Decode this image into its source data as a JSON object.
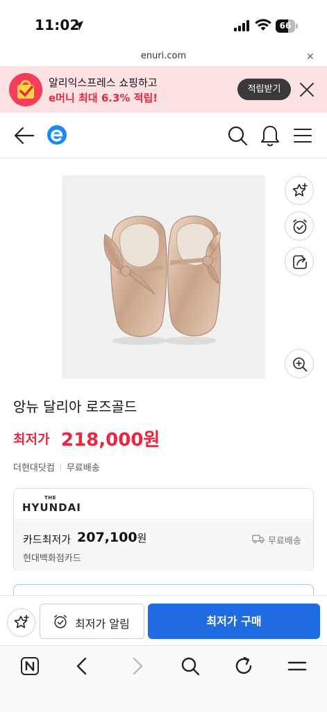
{
  "status_bar": {
    "time": "11:02",
    "battery": "66",
    "battery_level": 0.66
  },
  "browser": {
    "url": "enuri.com"
  },
  "promo": {
    "line1": "알리익스프레스 쇼핑하고",
    "line2": "e머니 최대 6.3% 적립!",
    "button_label": "적립받기"
  },
  "product": {
    "title": "앙뉴 달리아 로즈골드",
    "price_label": "최저가",
    "price": "218,000원",
    "seller": "더현대닷컴",
    "shipping": "무료배송"
  },
  "card_offer": {
    "brand_small": "THE",
    "brand": "HYUNDAI",
    "price_label": "카드최저가",
    "price": "207,100",
    "unit": "원",
    "card_name": "현대백화점카드",
    "shipping": "무료배송"
  },
  "actions": {
    "alert_label": "최저가 알림",
    "buy_label": "최저가 구매"
  },
  "colors": {
    "accent_red": "#e8273f",
    "primary_blue": "#1f6be0",
    "promo_bg": "#fde2e4"
  }
}
